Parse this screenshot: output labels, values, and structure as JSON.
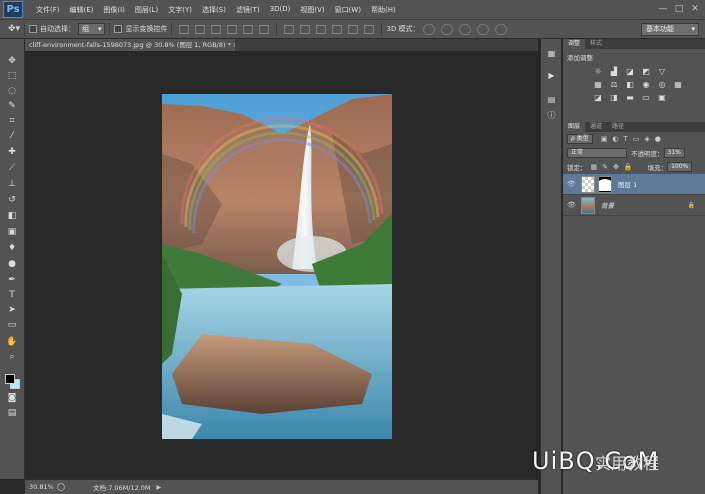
{
  "app": {
    "logo": "Ps"
  },
  "menu": [
    "文件(F)",
    "编辑(E)",
    "图像(I)",
    "图层(L)",
    "文字(Y)",
    "选择(S)",
    "滤镜(T)",
    "3D(D)",
    "视图(V)",
    "窗口(W)",
    "帮助(H)"
  ],
  "window_controls": {
    "minimize": "—",
    "maximize": "□",
    "close": "✕"
  },
  "options": {
    "auto_select_label": "自动选择：",
    "auto_select_value": "组",
    "show_transform_label": "显示变换控件",
    "mode_3d_label": "3D 模式：",
    "workspace": "基本功能"
  },
  "document": {
    "tab_title": "cliff-environment-falls-1598073.jpg @ 30.8% (图层 1, RGB/8) * ×"
  },
  "status": {
    "zoom": "30.81%",
    "doc_size": "文档:7.06M/12.0M"
  },
  "panels": {
    "adjust_tabs": [
      "调整",
      "样式"
    ],
    "adjust_title": "添加调整",
    "layers_tabs": [
      "图层",
      "通道",
      "路径"
    ],
    "filter_kind": "ρ 类型",
    "blend_mode": "正常",
    "opacity_label": "不透明度：",
    "opacity_value": "31%",
    "lock_label": "锁定：",
    "fill_label": "填充：",
    "fill_value": "100%",
    "layers": [
      {
        "name": "图层 1",
        "active": true
      },
      {
        "name": "背景",
        "active": false
      }
    ]
  },
  "watermark": {
    "brand": "UiBQ.CoM",
    "cn": "实用教程"
  }
}
